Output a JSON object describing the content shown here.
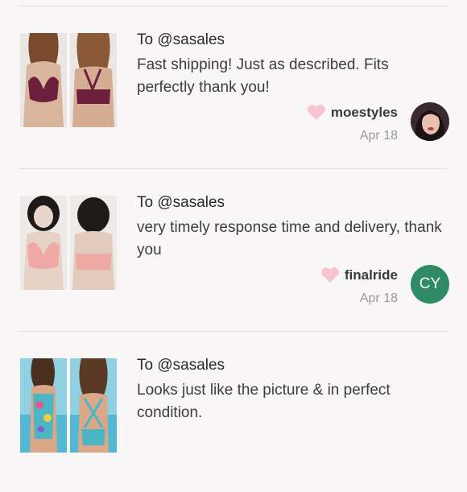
{
  "reviews": [
    {
      "to": "To @sasales",
      "text": "Fast shipping! Just as described. Fits perfectly thank you!",
      "username": "moestyles",
      "date": "Apr 18",
      "avatar": {
        "type": "photo"
      },
      "product_color": "#6b1f3c"
    },
    {
      "to": "To @sasales",
      "text": "very timely response time and delivery, thank you",
      "username": "finalride",
      "date": "Apr 18",
      "avatar": {
        "type": "initials",
        "initials": "CY",
        "color": "#2e8b66"
      },
      "product_color": "#f0a8a4"
    },
    {
      "to": "To @sasales",
      "text": "Looks just like the picture & in perfect condition.",
      "product_color": "#4cb6c4"
    }
  ],
  "colors": {
    "heart": "#f6c4cc",
    "divider": "#e2dfe1"
  }
}
